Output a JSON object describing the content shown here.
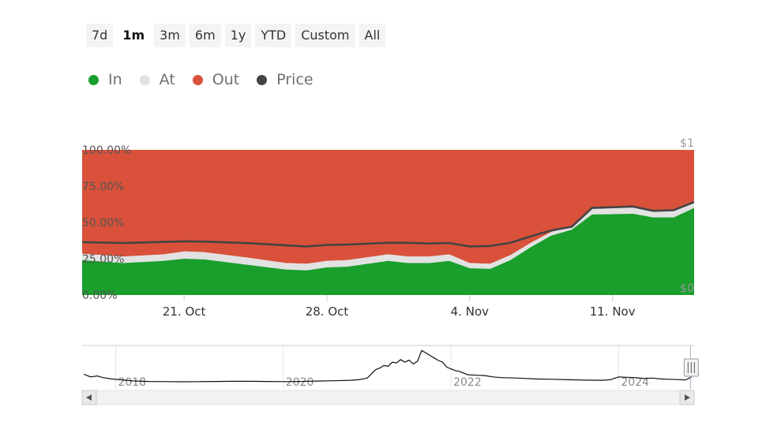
{
  "range_selector": {
    "buttons": [
      "7d",
      "1m",
      "3m",
      "6m",
      "1y",
      "YTD",
      "Custom",
      "All"
    ],
    "active": "1m"
  },
  "colors": {
    "in": "#1a9e2c",
    "at": "#e2e2e2",
    "out": "#d9513a",
    "price": "#444444",
    "navigator_line": "#111111",
    "grid": "#e6e6e6"
  },
  "chart_data": [
    {
      "type": "area",
      "stacking": "percent",
      "x": [
        "2024-10-16",
        "2024-10-18",
        "2024-10-20",
        "2024-10-21",
        "2024-10-22",
        "2024-10-24",
        "2024-10-26",
        "2024-10-27",
        "2024-10-28",
        "2024-10-29",
        "2024-10-31",
        "2024-11-01",
        "2024-11-02",
        "2024-11-03",
        "2024-11-04",
        "2024-11-05",
        "2024-11-06",
        "2024-11-07",
        "2024-11-08",
        "2024-11-09",
        "2024-11-10",
        "2024-11-12",
        "2024-11-13",
        "2024-11-14",
        "2024-11-15"
      ],
      "series": [
        {
          "name": "In",
          "values": [
            24,
            22,
            23.5,
            25,
            24.5,
            21,
            17.5,
            17,
            19,
            19.5,
            23.5,
            22,
            22,
            23.5,
            18.5,
            18,
            24,
            33,
            41,
            45,
            55.5,
            56,
            53.5,
            53.5,
            60
          ]
        },
        {
          "name": "At",
          "values": [
            4.5,
            4.5,
            4.5,
            5,
            5,
            5,
            4.5,
            4.5,
            4.5,
            4.5,
            4.5,
            4.5,
            4.5,
            4.5,
            3.5,
            3.5,
            3.5,
            3,
            2.5,
            2,
            4.5,
            5,
            4.5,
            5,
            4.5
          ]
        },
        {
          "name": "Out",
          "values": [
            71.5,
            73.5,
            72,
            70,
            70.5,
            74,
            78,
            78.5,
            76.5,
            76,
            72,
            73.5,
            73.5,
            72,
            78,
            78.5,
            72.5,
            64,
            56.5,
            53,
            40,
            39,
            42,
            41.5,
            35.5
          ]
        },
        {
          "name": "Price",
          "values": [
            0.364,
            0.358,
            0.366,
            0.37,
            0.368,
            0.358,
            0.342,
            0.335,
            0.345,
            0.348,
            0.36,
            0.36,
            0.355,
            0.358,
            0.335,
            0.338,
            0.36,
            0.405,
            0.445,
            0.47,
            0.6,
            0.61,
            0.58,
            0.585,
            0.64
          ]
        }
      ],
      "x_ticks": [
        {
          "date": "2024-10-21",
          "label": "21. Oct"
        },
        {
          "date": "2024-10-28",
          "label": "28. Oct"
        },
        {
          "date": "2024-11-04",
          "label": "4. Nov"
        },
        {
          "date": "2024-11-11",
          "label": "11. Nov"
        }
      ],
      "y_ticks": [
        "100.00%",
        "75.00%",
        "50.00%",
        "25.00%",
        "0.00%"
      ],
      "ylim": [
        0,
        100
      ],
      "y2_ticks": [
        "$1",
        "$0"
      ],
      "y2lim": [
        0,
        1
      ],
      "legend": "top-left",
      "grid": false
    },
    {
      "type": "line",
      "role": "navigator",
      "x_ticks": [
        "2018",
        "2020",
        "2022",
        "2024"
      ],
      "xlim": [
        2017.6,
        2024.9
      ],
      "x": [
        2017.62,
        2017.65,
        2017.7,
        2017.78,
        2017.85,
        2017.95,
        2018.05,
        2018.2,
        2018.4,
        2018.6,
        2018.8,
        2019.0,
        2019.2,
        2019.4,
        2019.6,
        2019.8,
        2020.0,
        2020.2,
        2020.4,
        2020.6,
        2020.8,
        2020.9,
        2021.0,
        2021.1,
        2021.15,
        2021.2,
        2021.25,
        2021.3,
        2021.35,
        2021.4,
        2021.45,
        2021.5,
        2021.55,
        2021.6,
        2021.65,
        2021.7,
        2021.75,
        2021.8,
        2021.85,
        2021.9,
        2021.95,
        2022.0,
        2022.05,
        2022.1,
        2022.15,
        2022.2,
        2022.3,
        2022.4,
        2022.5,
        2022.6,
        2022.8,
        2023.0,
        2023.2,
        2023.4,
        2023.6,
        2023.8,
        2023.9,
        2024.0,
        2024.1,
        2024.2,
        2024.3,
        2024.4,
        2024.5,
        2024.6,
        2024.7,
        2024.8,
        2024.87
      ],
      "values": [
        0.78,
        0.72,
        0.62,
        0.68,
        0.58,
        0.5,
        0.45,
        0.38,
        0.35,
        0.34,
        0.33,
        0.34,
        0.35,
        0.36,
        0.36,
        0.35,
        0.34,
        0.35,
        0.37,
        0.39,
        0.42,
        0.45,
        0.55,
        1.05,
        1.15,
        1.3,
        1.25,
        1.5,
        1.45,
        1.65,
        1.5,
        1.62,
        1.4,
        1.55,
        2.2,
        2.05,
        1.9,
        1.75,
        1.6,
        1.5,
        1.2,
        1.1,
        1.0,
        0.95,
        0.85,
        0.75,
        0.72,
        0.7,
        0.62,
        0.58,
        0.55,
        0.5,
        0.48,
        0.45,
        0.43,
        0.42,
        0.45,
        0.62,
        0.6,
        0.58,
        0.52,
        0.55,
        0.5,
        0.48,
        0.46,
        0.44,
        0.62
      ],
      "ylim": [
        0,
        2.4
      ]
    }
  ]
}
